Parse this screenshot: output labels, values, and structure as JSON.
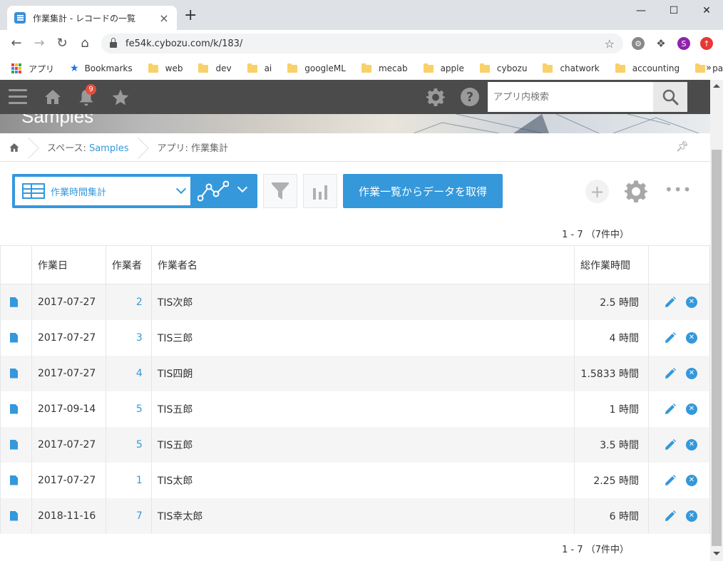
{
  "browser": {
    "tab_title": "作業集計 - レコードの一覧",
    "tab_close": "×",
    "new_tab": "+",
    "url": "fe54k.cybozu.com/k/183/",
    "profile_initial": "S",
    "bookmarks": [
      {
        "label": "アプリ",
        "kind": "apps"
      },
      {
        "label": "Bookmarks",
        "kind": "star"
      },
      {
        "label": "web",
        "kind": "folder"
      },
      {
        "label": "dev",
        "kind": "folder"
      },
      {
        "label": "ai",
        "kind": "folder"
      },
      {
        "label": "googleML",
        "kind": "folder"
      },
      {
        "label": "mecab",
        "kind": "folder"
      },
      {
        "label": "apple",
        "kind": "folder"
      },
      {
        "label": "cybozu",
        "kind": "folder"
      },
      {
        "label": "chatwork",
        "kind": "folder"
      },
      {
        "label": "accounting",
        "kind": "folder"
      },
      {
        "label": "pay",
        "kind": "folder"
      }
    ],
    "bookmarks_more": "»"
  },
  "header": {
    "notification_count": "9",
    "search_placeholder": "アプリ内検索"
  },
  "banner": {
    "text": "Samples"
  },
  "breadcrumb": {
    "space_prefix": "スペース: ",
    "space_name": "Samples",
    "app_label": "アプリ: 作業集計"
  },
  "toolbar": {
    "view_name": "作業時間集計",
    "action_label": "作業一覧からデータを取得",
    "add_label": "+",
    "more_label": "•••"
  },
  "pager": {
    "text": "1 - 7 （7件中）"
  },
  "table": {
    "columns": [
      "",
      "作業日",
      "作業者",
      "作業者名",
      "総作業時間",
      ""
    ],
    "rows": [
      {
        "date": "2017-07-27",
        "worker": "2",
        "name": "TIS次郎",
        "hours": "2.5 時間"
      },
      {
        "date": "2017-07-27",
        "worker": "3",
        "name": "TIS三郎",
        "hours": "4 時間"
      },
      {
        "date": "2017-07-27",
        "worker": "4",
        "name": "TIS四朗",
        "hours": "1.5833 時間"
      },
      {
        "date": "2017-09-14",
        "worker": "5",
        "name": "TIS五郎",
        "hours": "1 時間"
      },
      {
        "date": "2017-07-27",
        "worker": "5",
        "name": "TIS五郎",
        "hours": "3.5 時間"
      },
      {
        "date": "2017-07-27",
        "worker": "1",
        "name": "TIS太郎",
        "hours": "2.25 時間"
      },
      {
        "date": "2018-11-16",
        "worker": "7",
        "name": "TIS幸太郎",
        "hours": "6 時間"
      }
    ]
  },
  "colors": {
    "accent": "#3498db",
    "header_bg": "#4b4b4b",
    "row_alt": "#f5f5f5"
  }
}
